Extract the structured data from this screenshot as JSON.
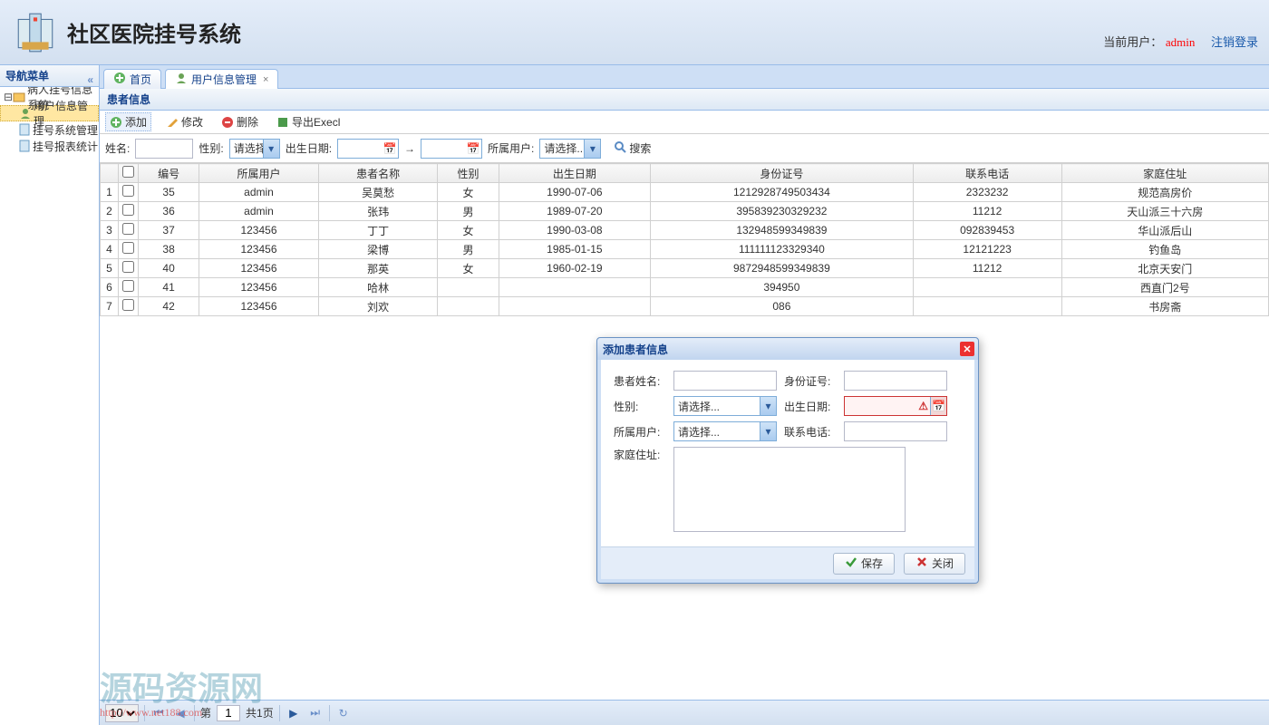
{
  "header": {
    "app_title": "社区医院挂号系统",
    "current_user_label": "当前用户：",
    "current_user": "admin",
    "logout": "注销登录"
  },
  "sidebar": {
    "title": "导航菜单",
    "root": "病人挂号信息系统",
    "items": [
      {
        "label": "用户信息管理",
        "active": true
      },
      {
        "label": "挂号系统管理",
        "active": false
      },
      {
        "label": "挂号报表统计",
        "active": false
      }
    ]
  },
  "tabs": [
    {
      "label": "首页",
      "closable": false,
      "icon": "plus-icon"
    },
    {
      "label": "用户信息管理",
      "closable": true,
      "icon": "user-icon",
      "active": true
    }
  ],
  "panel": {
    "title": "患者信息",
    "tools": {
      "add": "添加",
      "edit": "修改",
      "del": "删除",
      "export": "导出Execl"
    },
    "search": {
      "name_label": "姓名:",
      "sex_label": "性别:",
      "sex_placeholder": "请选择...",
      "birth_label": "出生日期:",
      "owner_label": "所属用户:",
      "owner_placeholder": "请选择...",
      "btn": "搜索"
    },
    "columns": [
      "编号",
      "所属用户",
      "患者名称",
      "性别",
      "出生日期",
      "身份证号",
      "联系电话",
      "家庭住址"
    ],
    "rows": [
      {
        "n": 1,
        "id": 35,
        "owner": "admin",
        "name": "吴莫愁",
        "sex": "女",
        "birth": "1990-07-06",
        "idno": "1212928749503434",
        "tel": "2323232",
        "addr": "规范高房价"
      },
      {
        "n": 2,
        "id": 36,
        "owner": "admin",
        "name": "张玮",
        "sex": "男",
        "birth": "1989-07-20",
        "idno": "395839230329232",
        "tel": "11212",
        "addr": "天山派三十六房"
      },
      {
        "n": 3,
        "id": 37,
        "owner": "123456",
        "name": "丁丁",
        "sex": "女",
        "birth": "1990-03-08",
        "idno": "132948599349839",
        "tel": "092839453",
        "addr": "华山派后山"
      },
      {
        "n": 4,
        "id": 38,
        "owner": "123456",
        "name": "梁博",
        "sex": "男",
        "birth": "1985-01-15",
        "idno": "111111123329340",
        "tel": "12121223",
        "addr": "钓鱼岛"
      },
      {
        "n": 5,
        "id": 40,
        "owner": "123456",
        "name": "那英",
        "sex": "女",
        "birth": "1960-02-19",
        "idno": "9872948599349839",
        "tel": "11212",
        "addr": "北京天安门"
      },
      {
        "n": 6,
        "id": 41,
        "owner": "123456",
        "name": "哈林",
        "sex": "",
        "birth": "",
        "idno": "394950",
        "tel": "",
        "addr": "西直门2号"
      },
      {
        "n": 7,
        "id": 42,
        "owner": "123456",
        "name": "刘欢",
        "sex": "",
        "birth": "",
        "idno": "086",
        "tel": "",
        "addr": "书房斋"
      }
    ]
  },
  "pager": {
    "page_size": "10",
    "page_label_prefix": "第",
    "page": "1",
    "total_label": "共1页"
  },
  "dialog": {
    "title": "添加患者信息",
    "fields": {
      "name": "患者姓名:",
      "idno": "身份证号:",
      "sex": "性别:",
      "sex_placeholder": "请选择...",
      "birth": "出生日期:",
      "owner": "所属用户:",
      "owner_placeholder": "请选择...",
      "tel": "联系电话:",
      "addr": "家庭住址:"
    },
    "buttons": {
      "save": "保存",
      "close": "关闭"
    }
  },
  "watermark": {
    "text": "源码资源网",
    "url": "http://www.net188.com"
  }
}
